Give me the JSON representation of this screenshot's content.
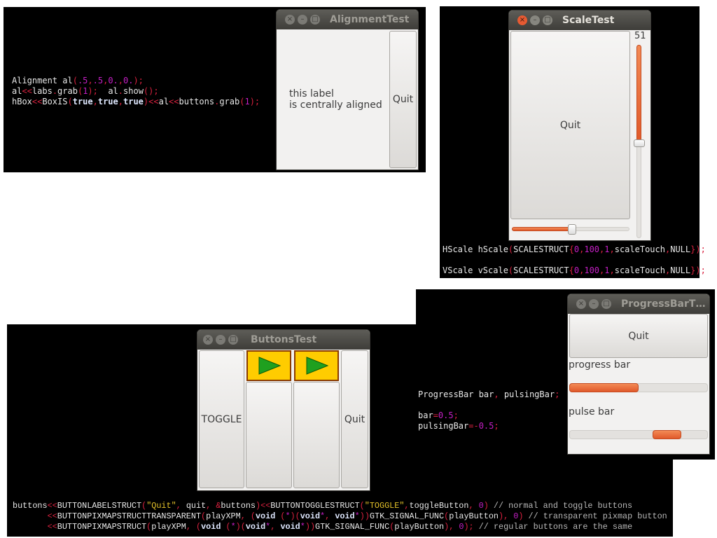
{
  "colors": {
    "accent": "#e0592a",
    "pixmap_bg": "#ffcc00",
    "play": "#1fa01f"
  },
  "alignment": {
    "title": "AlignmentTest",
    "label": "this label\nis centrally aligned",
    "quit": "Quit",
    "code": [
      [
        [
          "Alignment al",
          "w"
        ],
        [
          "(",
          "p"
        ],
        [
          ".5",
          "n"
        ],
        [
          ",",
          "p"
        ],
        [
          ".5",
          "n"
        ],
        [
          ",",
          "p"
        ],
        [
          "0.",
          "n"
        ],
        [
          ",",
          "p"
        ],
        [
          "0.",
          "n"
        ],
        [
          ");",
          "p"
        ]
      ],
      [
        [
          "al",
          "w"
        ],
        [
          "<<",
          "p"
        ],
        [
          "labs",
          "w"
        ],
        [
          ".",
          "p"
        ],
        [
          "grab",
          "w"
        ],
        [
          "(",
          "p"
        ],
        [
          "1",
          "n"
        ],
        [
          ");",
          "p"
        ],
        [
          "  al",
          "w"
        ],
        [
          ".",
          "p"
        ],
        [
          "show",
          "w"
        ],
        [
          "();",
          "p"
        ]
      ],
      [
        [
          "hBox",
          "w"
        ],
        [
          "<<",
          "p"
        ],
        [
          "BoxIS",
          "w"
        ],
        [
          "(",
          "p"
        ],
        [
          "true",
          "k"
        ],
        [
          ",",
          "p"
        ],
        [
          "true",
          "k"
        ],
        [
          ",",
          "p"
        ],
        [
          "true",
          "k"
        ],
        [
          ")<<",
          "p"
        ],
        [
          "al",
          "w"
        ],
        [
          "<<",
          "p"
        ],
        [
          "buttons",
          "w"
        ],
        [
          ".",
          "p"
        ],
        [
          "grab",
          "w"
        ],
        [
          "(",
          "p"
        ],
        [
          "1",
          "n"
        ],
        [
          ");",
          "p"
        ]
      ]
    ]
  },
  "scale": {
    "title": "ScaleTest",
    "quit": "Quit",
    "vscale_value": "51",
    "hscale_value": 51,
    "range": [
      0,
      100
    ],
    "code": [
      [
        [
          "HScale hScale",
          "w"
        ],
        [
          "(",
          "p"
        ],
        [
          "SCALESTRUCT",
          "w"
        ],
        [
          "{",
          "p"
        ],
        [
          "0",
          "n"
        ],
        [
          ",",
          "p"
        ],
        [
          "100",
          "n"
        ],
        [
          ",",
          "p"
        ],
        [
          "1",
          "n"
        ],
        [
          ",",
          "p"
        ],
        [
          "scaleTouch",
          "w"
        ],
        [
          ",",
          "p"
        ],
        [
          "NULL",
          "w"
        ],
        [
          "});",
          "p"
        ]
      ],
      [
        [
          "",
          "w"
        ]
      ],
      [
        [
          "VScale vScale",
          "w"
        ],
        [
          "(",
          "p"
        ],
        [
          "SCALESTRUCT",
          "w"
        ],
        [
          "{",
          "p"
        ],
        [
          "0",
          "n"
        ],
        [
          ",",
          "p"
        ],
        [
          "100",
          "n"
        ],
        [
          ",",
          "p"
        ],
        [
          "1",
          "n"
        ],
        [
          ",",
          "p"
        ],
        [
          "scaleTouch",
          "w"
        ],
        [
          ",",
          "p"
        ],
        [
          "NULL",
          "w"
        ],
        [
          "});",
          "p"
        ]
      ]
    ]
  },
  "buttons": {
    "title": "ButtonsTest",
    "toggle": "TOGGLE",
    "quit": "Quit",
    "code": [
      [
        [
          "buttons",
          "w"
        ],
        [
          "<<",
          "p"
        ],
        [
          "BUTTONLABELSTRUCT",
          "w"
        ],
        [
          "(",
          "p"
        ],
        [
          "\"Quit\"",
          "s"
        ],
        [
          ",",
          "p"
        ],
        [
          " quit",
          "w"
        ],
        [
          ", &",
          "p"
        ],
        [
          "buttons",
          "w"
        ],
        [
          ")<<",
          "p"
        ],
        [
          "BUTTONTOGGLESTRUCT",
          "w"
        ],
        [
          "(",
          "p"
        ],
        [
          "\"TOGGLE\"",
          "s"
        ],
        [
          ",",
          "p"
        ],
        [
          "toggleButton",
          "w"
        ],
        [
          ",",
          "p"
        ],
        [
          " 0",
          "n"
        ],
        [
          ")",
          "p"
        ],
        [
          " // normal and toggle buttons",
          "c"
        ]
      ],
      [
        [
          "       ",
          "w"
        ],
        [
          "<<",
          "p"
        ],
        [
          "BUTTONPIXMAPSTRUCTTRANSPARENT",
          "w"
        ],
        [
          "(",
          "p"
        ],
        [
          "playXPM",
          "w"
        ],
        [
          ", (",
          "p"
        ],
        [
          "void",
          "k"
        ],
        [
          " (",
          "p"
        ],
        [
          "*",
          "n"
        ],
        [
          ")(",
          "p"
        ],
        [
          "void",
          "k"
        ],
        [
          "*",
          "n"
        ],
        [
          ", ",
          "p"
        ],
        [
          "void",
          "k"
        ],
        [
          "*",
          "n"
        ],
        [
          "))",
          "p"
        ],
        [
          "GTK_SIGNAL_FUNC",
          "w"
        ],
        [
          "(",
          "p"
        ],
        [
          "playButton",
          "w"
        ],
        [
          "),",
          "p"
        ],
        [
          " 0",
          "n"
        ],
        [
          ")",
          "p"
        ],
        [
          " // transparent pixmap button",
          "c"
        ]
      ],
      [
        [
          "       ",
          "w"
        ],
        [
          "<<",
          "p"
        ],
        [
          "BUTTONPIXMAPSTRUCT",
          "w"
        ],
        [
          "(",
          "p"
        ],
        [
          "playXPM",
          "w"
        ],
        [
          ", (",
          "p"
        ],
        [
          "void",
          "k"
        ],
        [
          " (",
          "p"
        ],
        [
          "*",
          "n"
        ],
        [
          ")(",
          "p"
        ],
        [
          "void",
          "k"
        ],
        [
          "*",
          "n"
        ],
        [
          ", ",
          "p"
        ],
        [
          "void",
          "k"
        ],
        [
          "*",
          "n"
        ],
        [
          "))",
          "p"
        ],
        [
          "GTK_SIGNAL_FUNC",
          "w"
        ],
        [
          "(",
          "p"
        ],
        [
          "playButton",
          "w"
        ],
        [
          "),",
          "p"
        ],
        [
          " 0",
          "n"
        ],
        [
          ");",
          "p"
        ],
        [
          " // regular buttons are the same",
          "c"
        ]
      ]
    ]
  },
  "progress": {
    "title": "ProgressBarT…",
    "quit": "Quit",
    "progress_label": "progress bar",
    "pulse_label": "pulse bar",
    "progress_fraction": 0.5,
    "code": [
      [
        [
          "ProgressBar bar",
          "w"
        ],
        [
          ",",
          "p"
        ],
        [
          " pulsingBar",
          "w"
        ],
        [
          ";",
          "p"
        ]
      ],
      [
        [
          "",
          "w"
        ]
      ],
      [
        [
          "bar",
          "w"
        ],
        [
          "=",
          "p"
        ],
        [
          "0.5",
          "n"
        ],
        [
          ";",
          "p"
        ]
      ],
      [
        [
          "pulsingBar",
          "w"
        ],
        [
          "=-",
          "p"
        ],
        [
          "0.5",
          "n"
        ],
        [
          ";",
          "p"
        ]
      ]
    ]
  }
}
